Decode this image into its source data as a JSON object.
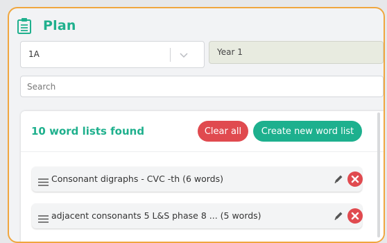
{
  "header": {
    "title": "Plan",
    "icon": "clipboard-icon",
    "accent": "#1fb08d",
    "border_color": "#f0a63e"
  },
  "filters": {
    "class_select": {
      "value": "1A"
    },
    "year": {
      "value": "Year 1"
    },
    "search": {
      "placeholder": "Search",
      "value": ""
    }
  },
  "word_lists": {
    "count_label": "10 word lists found",
    "clear_all_label": "Clear all",
    "create_label": "Create new word list",
    "items": [
      {
        "label": "Consonant digraphs - CVC -th (6 words)"
      },
      {
        "label": "adjacent consonants 5 L&S phase 8 ... (5 words)"
      }
    ]
  },
  "colors": {
    "clear_button": "#e04a4f",
    "create_button": "#1db08e",
    "delete_icon": "#e04a4f"
  }
}
